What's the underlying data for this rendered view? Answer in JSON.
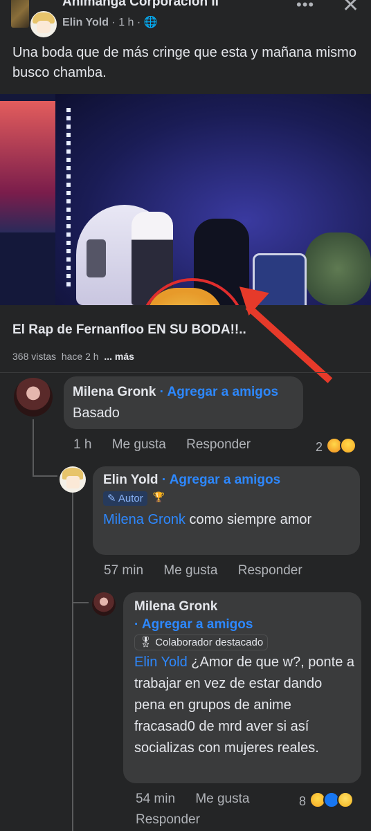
{
  "header": {
    "group_name": "Animanga Corporación II",
    "author": "Elin Yold",
    "time": "1 h",
    "separator": "·"
  },
  "post": {
    "text": "Una boda que de más cringe que esta y mañana mismo busco chamba."
  },
  "video": {
    "title": "El Rap de Fernanfloo EN SU BODA!!..",
    "views": "368 vistas",
    "age": "hace 2 h",
    "more": "... más"
  },
  "comments": [
    {
      "name": "Milena Gronk",
      "add_friend": "· Agregar a amigos",
      "text": "Basado",
      "time": "1 h",
      "like": "Me gusta",
      "reply": "Responder",
      "reaction_count": "2"
    },
    {
      "name": "Elin Yold",
      "add_friend": "· Agregar a amigos",
      "badge": "Autor",
      "mention": "Milena Gronk",
      "text": " como siempre amor",
      "time": "57 min",
      "like": "Me gusta",
      "reply": "Responder"
    },
    {
      "name": "Milena Gronk",
      "add_friend": "· Agregar a amigos",
      "badge": "Colaborador destacado",
      "mention": "Elin Yold",
      "text": " ¿Amor de que w?, ponte a trabajar en vez de estar dando pena en grupos de anime fracasad0 de mrd aver si así socializas con mujeres reales.",
      "time": "54 min",
      "like": "Me gusta",
      "reply": "Responder",
      "reaction_count": "8"
    }
  ],
  "icons": {
    "globe": "globe-icon",
    "more": "more-options-icon",
    "close": "close-icon",
    "pencil": "pencil-icon",
    "trophy": "trophy-icon",
    "medal": "medal-icon"
  },
  "colors": {
    "background": "#242526",
    "bubble": "#3a3b3c",
    "link": "#2d88ff",
    "arrow": "#e63a2a"
  }
}
